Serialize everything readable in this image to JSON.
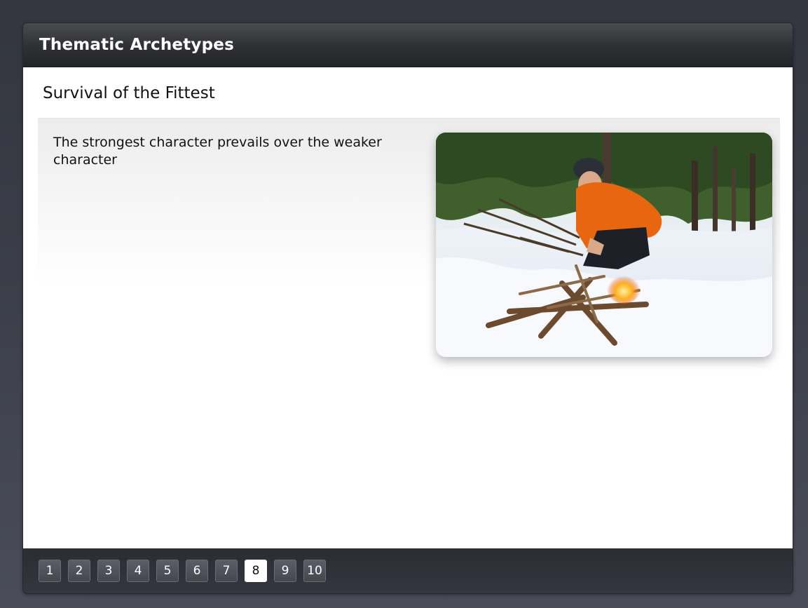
{
  "header": {
    "title": "Thematic Archetypes"
  },
  "slide": {
    "heading": "Survival of the Fittest",
    "body": "The strongest character prevails over the weaker character",
    "image_alt": "Man in orange jacket lighting a campfire in the snowy woods"
  },
  "pagination": {
    "pages": [
      "1",
      "2",
      "3",
      "4",
      "5",
      "6",
      "7",
      "8",
      "9",
      "10"
    ],
    "current_page": "8"
  },
  "colors": {
    "header_bg": "#2f3034",
    "active_page_bg": "#ffffff",
    "page_button_bg": "#4c4f56"
  }
}
